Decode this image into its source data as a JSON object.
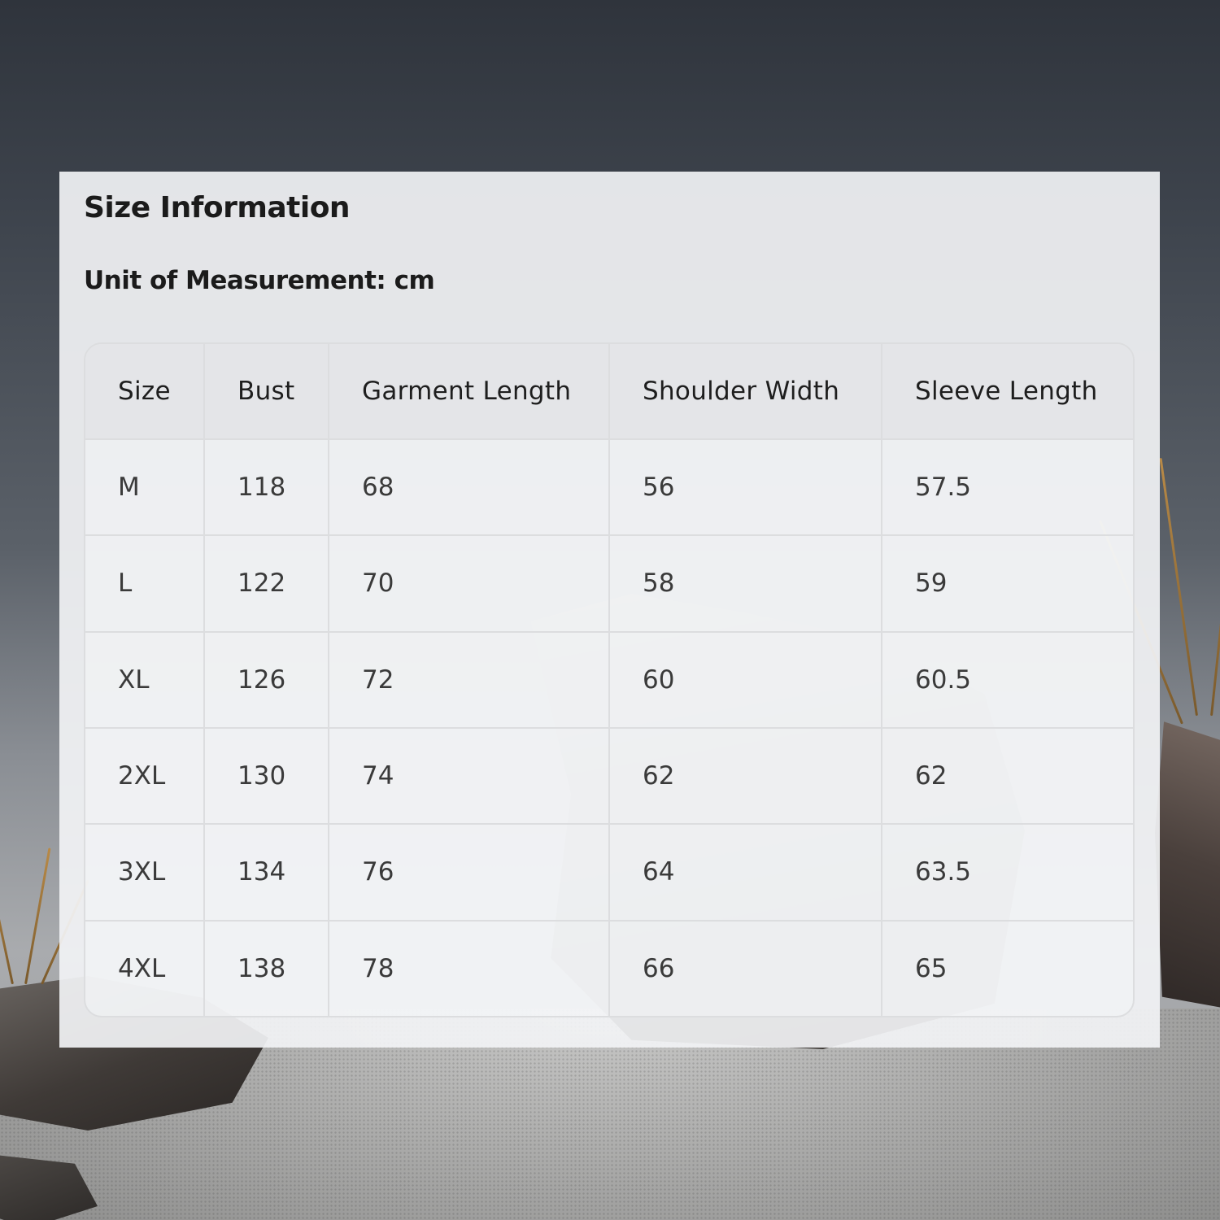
{
  "size_chart": {
    "title": "Size Information",
    "unit_label": "Unit of Measurement: cm",
    "headers": [
      "Size",
      "Bust",
      "Garment Length",
      "Shoulder Width",
      "Sleeve Length"
    ],
    "rows": [
      [
        "M",
        "118",
        "68",
        "56",
        "57.5"
      ],
      [
        "L",
        "122",
        "70",
        "58",
        "59"
      ],
      [
        "XL",
        "126",
        "72",
        "60",
        "60.5"
      ],
      [
        "2XL",
        "130",
        "74",
        "62",
        "62"
      ],
      [
        "3XL",
        "134",
        "76",
        "64",
        "63.5"
      ],
      [
        "4XL",
        "138",
        "78",
        "66",
        "65"
      ]
    ]
  },
  "colors": {
    "panel_background": "#f2f3f5",
    "header_background": "#e2e3e6",
    "grid_line": "#dcdddf",
    "text_primary": "#1b1b1b"
  }
}
